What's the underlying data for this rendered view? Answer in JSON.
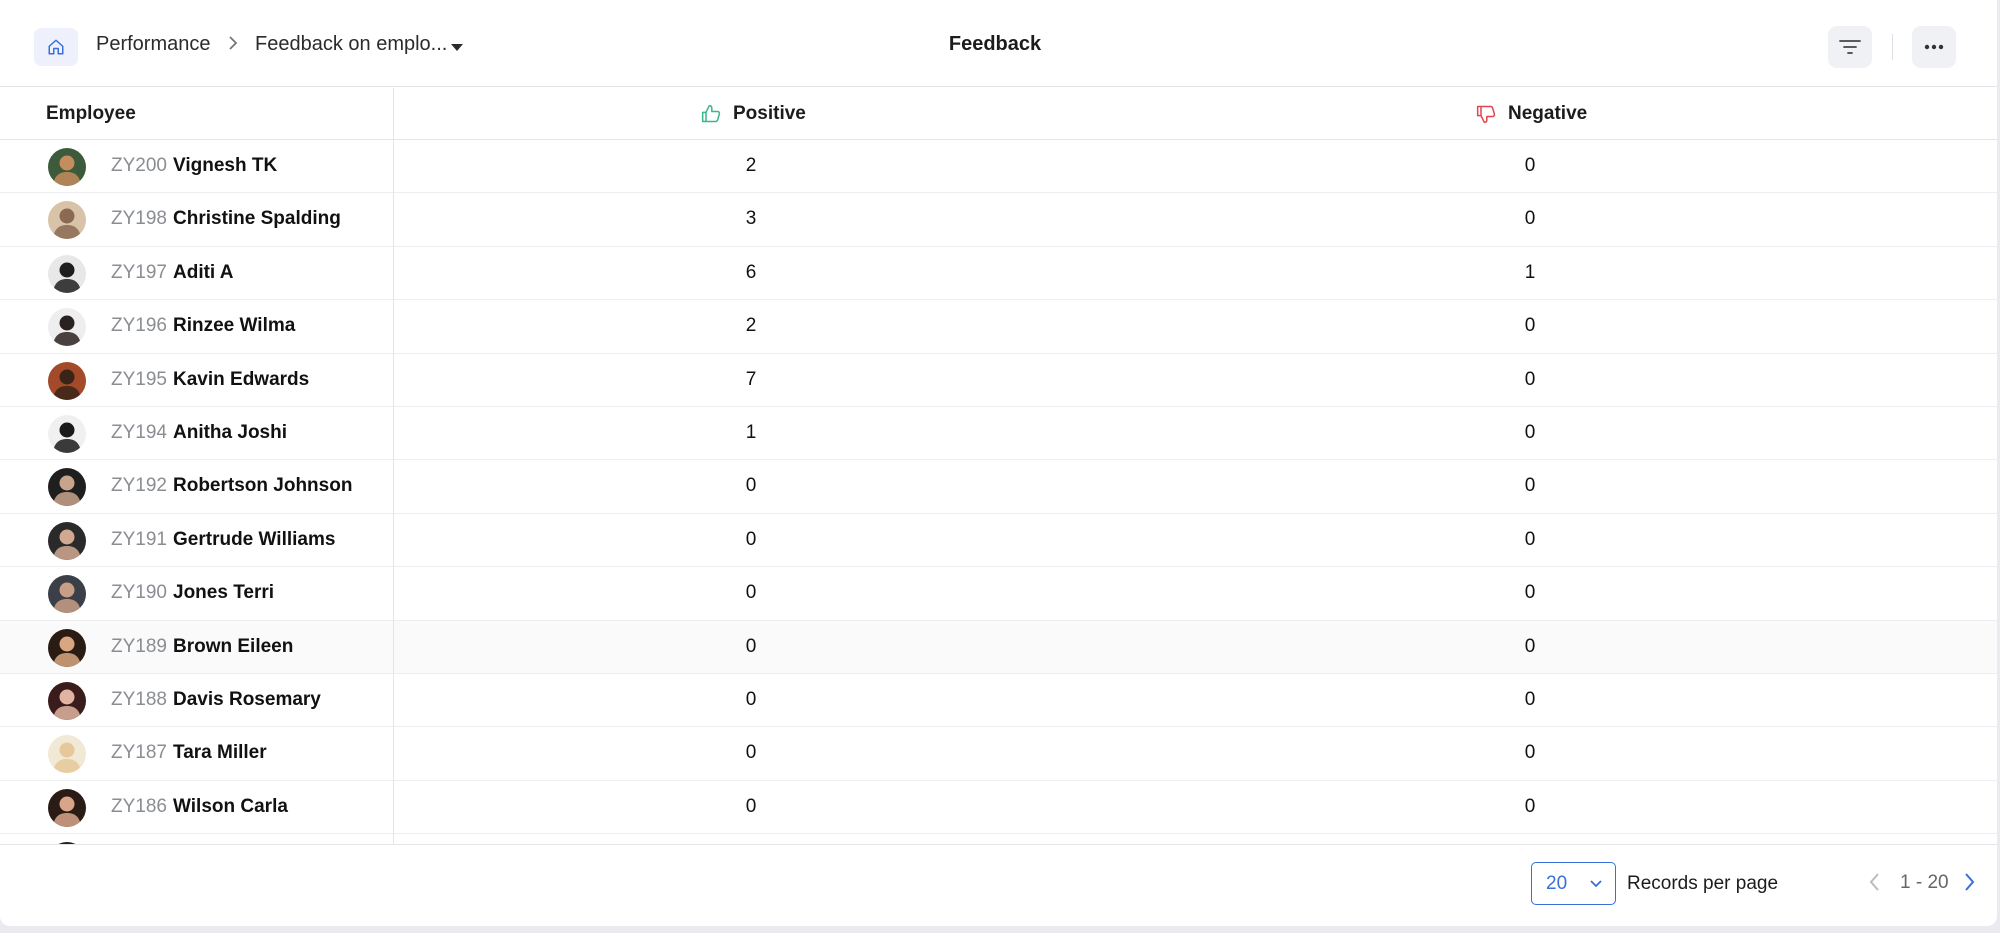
{
  "header": {
    "breadcrumb": [
      "Performance",
      "Feedback on emplo..."
    ],
    "title": "Feedback",
    "icons": [
      "home-icon",
      "filter-icon",
      "more-icon"
    ]
  },
  "table": {
    "columns": [
      "Employee",
      "Positive",
      "Negative"
    ],
    "rows": [
      {
        "id": "ZY200",
        "name": "Vignesh TK",
        "positive": "2",
        "negative": "0"
      },
      {
        "id": "ZY198",
        "name": "Christine Spalding",
        "positive": "3",
        "negative": "0"
      },
      {
        "id": "ZY197",
        "name": "Aditi A",
        "positive": "6",
        "negative": "1"
      },
      {
        "id": "ZY196",
        "name": "Rinzee Wilma",
        "positive": "2",
        "negative": "0"
      },
      {
        "id": "ZY195",
        "name": "Kavin Edwards",
        "positive": "7",
        "negative": "0"
      },
      {
        "id": "ZY194",
        "name": "Anitha Joshi",
        "positive": "1",
        "negative": "0"
      },
      {
        "id": "ZY192",
        "name": "Robertson Johnson",
        "positive": "0",
        "negative": "0"
      },
      {
        "id": "ZY191",
        "name": "Gertrude Williams",
        "positive": "0",
        "negative": "0"
      },
      {
        "id": "ZY190",
        "name": "Jones Terri",
        "positive": "0",
        "negative": "0"
      },
      {
        "id": "ZY189",
        "name": "Brown Eileen",
        "positive": "0",
        "negative": "0"
      },
      {
        "id": "ZY188",
        "name": "Davis Rosemary",
        "positive": "0",
        "negative": "0"
      },
      {
        "id": "ZY187",
        "name": "Tara Miller",
        "positive": "0",
        "negative": "0"
      },
      {
        "id": "ZY186",
        "name": "Wilson Carla",
        "positive": "0",
        "negative": "0"
      }
    ]
  },
  "footer": {
    "per_page_value": "20",
    "per_page_label": "Records per page",
    "range": "1 - 20"
  },
  "colors": {
    "accent": "#3a6fd8",
    "positive_icon": "#3bb58a",
    "negative_icon": "#e0464e"
  }
}
